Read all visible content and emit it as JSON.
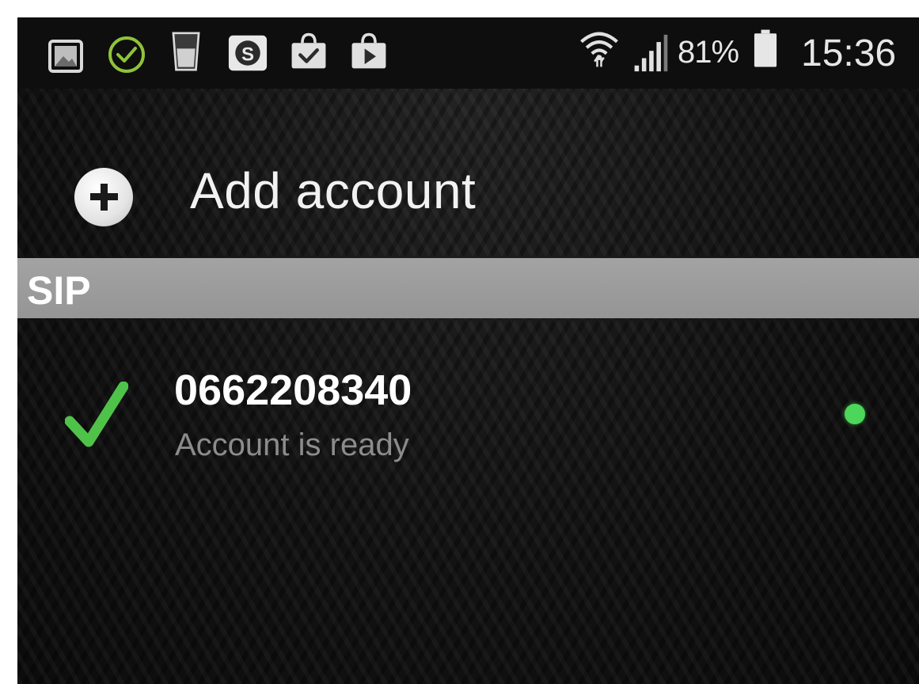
{
  "status_bar": {
    "icons": [
      "gallery-icon",
      "sync-check-icon",
      "glass-icon",
      "skype-icon",
      "store-check-icon",
      "play-store-icon",
      "wifi-icon",
      "signal-icon",
      "battery-icon"
    ],
    "battery_percent": "81%",
    "time": "15:36"
  },
  "header": {
    "add_account_label": "Add account",
    "icon": "plus-circle-icon"
  },
  "section": {
    "title": "SIP"
  },
  "accounts": [
    {
      "number": "0662208340",
      "status": "Account is ready",
      "check_icon": "checkmark-icon",
      "online_color": "#4cd65a"
    }
  ],
  "colors": {
    "accent_green": "#4cd65a",
    "check_green": "#4fc24a",
    "section_header_bg": "#9c9c9c",
    "background": "#141414"
  }
}
